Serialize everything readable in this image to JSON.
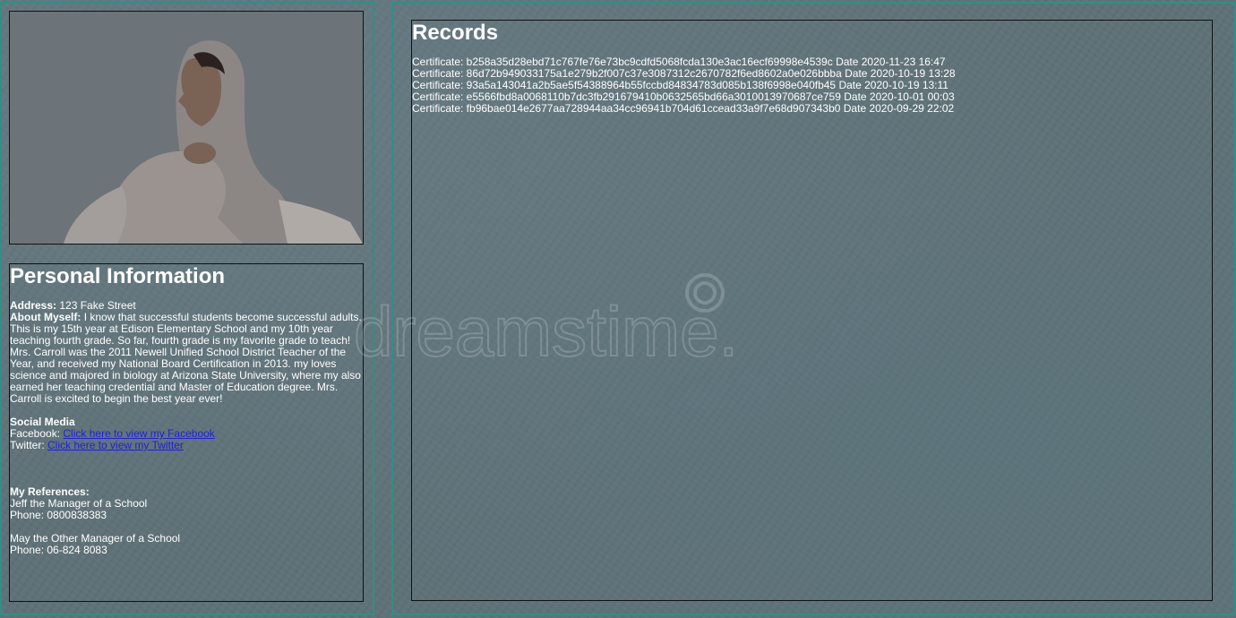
{
  "profile": {
    "photo_alt": "profile photo"
  },
  "personal": {
    "heading": "Personal Information",
    "address_label": "Address:",
    "address_value": "123 Fake Street",
    "about_label": "About Myself:",
    "about_text": "I know that successful students become successful adults. This is my 15th year at Edison Elementary School and my 10th year teaching fourth grade. So far, fourth grade is my favorite grade to teach! Mrs. Carroll was the 2011 Newell Unified School District Teacher of the Year, and received my National Board Certification in 2013. my loves science and majored in biology at Arizona State University, where my also earned her teaching credential and Master of Education degree. Mrs. Carroll is excited to begin the best year ever!",
    "social_heading": "Social Media",
    "facebook_label": "Facebook:",
    "facebook_link": "Click here to view my Facebook",
    "twitter_label": "Twitter:",
    "twitter_link": "Click here to view my Twitter",
    "references_heading": "My References:",
    "references": [
      {
        "name": "Jeff the Manager of a School",
        "phone": "Phone: 0800838383"
      },
      {
        "name": "May the Other Manager of a School",
        "phone": "Phone: 06-824 8083"
      }
    ]
  },
  "records": {
    "heading": "Records",
    "items": [
      "Certificate: b258a35d28ebd71c767fe76e73bc9cdfd5068fcda130e3ac16ecf69998e4539c Date 2020-11-23 16:47",
      "Certificate: 86d72b949033175a1e279b2f007c37e3087312c2670782f6ed8602a0e026bbba Date 2020-10-19 13:28",
      "Certificate: 93a5a143041a2b5ae5f54388964b55fccbd84834783d085b138f6998e040fb45 Date 2020-10-19 13:11",
      "Certificate: e5566fbd8a0068110b7dc3fb291679410b0632565bd66a3010013970687ce759 Date 2020-10-01 00:03",
      "Certificate: fb96bae014e2677aa728944aa34cc96941b704d61ccead33a9f7e68d907343b0 Date 2020-09-29 22:02"
    ]
  },
  "watermark": {
    "text": "dreamstime."
  }
}
